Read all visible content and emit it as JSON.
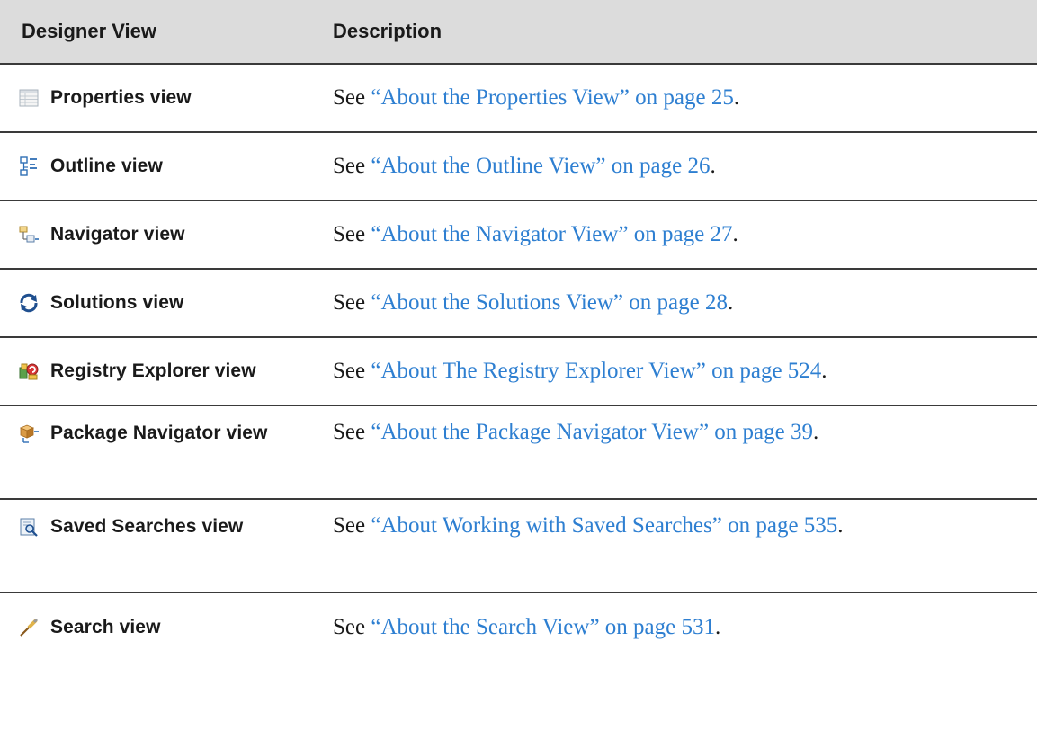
{
  "header": {
    "col1": "Designer View",
    "col2": "Description"
  },
  "rows": [
    {
      "name": "Properties view",
      "icon": "properties-icon",
      "prefix": "See",
      "link": "“About the Properties View” on page 25",
      "suffix": "."
    },
    {
      "name": "Outline view",
      "icon": "outline-icon",
      "prefix": "See",
      "link": "“About the Outline View” on page 26",
      "suffix": "."
    },
    {
      "name": "Navigator view",
      "icon": "navigator-icon",
      "prefix": "See",
      "link": "“About the Navigator View” on page 27",
      "suffix": "."
    },
    {
      "name": "Solutions view",
      "icon": "solutions-icon",
      "prefix": "See",
      "link": "“About the Solutions View” on page 28",
      "suffix": "."
    },
    {
      "name": "Registry Explorer view",
      "icon": "registry-explorer-icon",
      "prefix": "See",
      "link": "“About The Registry Explorer View” on page 524",
      "suffix": "."
    },
    {
      "name": "Package Navigator view",
      "icon": "package-navigator-icon",
      "prefix": "See",
      "link": "“About the Package Navigator View” on page 39",
      "suffix": "."
    },
    {
      "name": "Saved Searches view",
      "icon": "saved-searches-icon",
      "prefix": "See",
      "link": "“About Working with Saved Searches” on page 535",
      "suffix": "."
    },
    {
      "name": "Search view",
      "icon": "search-icon",
      "prefix": "See",
      "link": "“About the Search View” on page 531",
      "suffix": "."
    }
  ],
  "colors": {
    "link": "#2e7fd1",
    "header_bg": "#dcdcdc",
    "rule": "#3a3a3a"
  }
}
